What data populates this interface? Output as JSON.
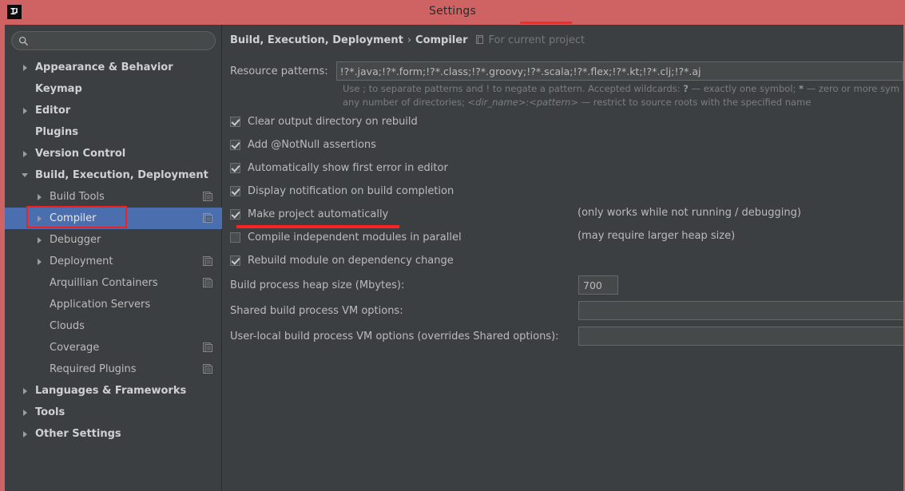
{
  "window": {
    "title": "Settings",
    "logo_icon": "intellij-idea-logo"
  },
  "sidebar": {
    "search": {
      "value": "",
      "placeholder": "",
      "icon": "search-icon"
    },
    "items": [
      {
        "label": "Appearance & Behavior",
        "level": 0,
        "twisty": "right",
        "bold": true,
        "scope_icon": false,
        "selected": false
      },
      {
        "label": "Keymap",
        "level": 0,
        "twisty": "none",
        "bold": true,
        "scope_icon": false,
        "selected": false
      },
      {
        "label": "Editor",
        "level": 0,
        "twisty": "right",
        "bold": true,
        "scope_icon": false,
        "selected": false
      },
      {
        "label": "Plugins",
        "level": 0,
        "twisty": "none",
        "bold": true,
        "scope_icon": false,
        "selected": false
      },
      {
        "label": "Version Control",
        "level": 0,
        "twisty": "right",
        "bold": true,
        "scope_icon": false,
        "selected": false
      },
      {
        "label": "Build, Execution, Deployment",
        "level": 0,
        "twisty": "down",
        "bold": true,
        "scope_icon": false,
        "selected": false
      },
      {
        "label": "Build Tools",
        "level": 1,
        "twisty": "right",
        "bold": false,
        "scope_icon": true,
        "selected": false
      },
      {
        "label": "Compiler",
        "level": 1,
        "twisty": "right",
        "bold": false,
        "scope_icon": true,
        "selected": true
      },
      {
        "label": "Debugger",
        "level": 1,
        "twisty": "right",
        "bold": false,
        "scope_icon": false,
        "selected": false
      },
      {
        "label": "Deployment",
        "level": 1,
        "twisty": "right",
        "bold": false,
        "scope_icon": true,
        "selected": false
      },
      {
        "label": "Arquillian Containers",
        "level": 1,
        "twisty": "none",
        "bold": false,
        "scope_icon": true,
        "selected": false
      },
      {
        "label": "Application Servers",
        "level": 1,
        "twisty": "none",
        "bold": false,
        "scope_icon": false,
        "selected": false
      },
      {
        "label": "Clouds",
        "level": 1,
        "twisty": "none",
        "bold": false,
        "scope_icon": false,
        "selected": false
      },
      {
        "label": "Coverage",
        "level": 1,
        "twisty": "none",
        "bold": false,
        "scope_icon": true,
        "selected": false
      },
      {
        "label": "Required Plugins",
        "level": 1,
        "twisty": "none",
        "bold": false,
        "scope_icon": true,
        "selected": false
      },
      {
        "label": "Languages & Frameworks",
        "level": 0,
        "twisty": "right",
        "bold": true,
        "scope_icon": false,
        "selected": false
      },
      {
        "label": "Tools",
        "level": 0,
        "twisty": "right",
        "bold": true,
        "scope_icon": false,
        "selected": false
      },
      {
        "label": "Other Settings",
        "level": 0,
        "twisty": "right",
        "bold": true,
        "scope_icon": false,
        "selected": false
      }
    ]
  },
  "content": {
    "breadcrumb": {
      "parent": "Build, Execution, Deployment",
      "separator": "›",
      "current": "Compiler",
      "scope_icon": "project-scope-icon",
      "scope_text": "For current project"
    },
    "resource_patterns": {
      "label": "Resource patterns:",
      "value": "!?*.java;!?*.form;!?*.class;!?*.groovy;!?*.scala;!?*.flex;!?*.kt;!?*.clj;!?*.aj"
    },
    "hint_line1_a": "Use ; to separate patterns and ! to negate a pattern. Accepted wildcards: ",
    "hint_wildcard_q": "?",
    "hint_line1_b": " — exactly one symbol; ",
    "hint_wildcard_star": "*",
    "hint_line1_c": " — zero or more sym",
    "hint_line2_a": "any number of directories;  ",
    "hint_dir_name": "<dir_name>:<pattern>",
    "hint_line2_b": " — restrict to source roots with the specified name",
    "checkboxes": [
      {
        "label": "Clear output directory on rebuild",
        "checked": true,
        "mnemonic": "l",
        "hint": ""
      },
      {
        "label": "Add @NotNull assertions",
        "checked": true,
        "mnemonic": "a",
        "hint": ""
      },
      {
        "label": "Automatically show first error in editor",
        "checked": true,
        "mnemonic": "e",
        "hint": ""
      },
      {
        "label": "Display notification on build completion",
        "checked": true,
        "mnemonic": "",
        "hint": ""
      },
      {
        "label": "Make project automatically",
        "checked": true,
        "mnemonic": "",
        "hint": "(only works while not running / debugging)"
      },
      {
        "label": "Compile independent modules in parallel",
        "checked": false,
        "mnemonic": "",
        "hint": "(may require larger heap size)"
      },
      {
        "label": "Rebuild module on dependency change",
        "checked": true,
        "mnemonic": "",
        "hint": ""
      }
    ],
    "fields": [
      {
        "label": "Build process heap size (Mbytes):",
        "value": "700",
        "wide": false
      },
      {
        "label": "Shared build process VM options:",
        "value": "",
        "wide": true
      },
      {
        "label": "User-local build process VM options (overrides Shared options):",
        "value": "",
        "wide": true
      }
    ]
  },
  "annotations": {
    "title_underline_color": "#fb2828",
    "compiler_box_color": "#f42020",
    "make_project_underline_color": "#fb2424"
  },
  "colors": {
    "titlebar": "#cf6363",
    "window_bg": "#3c3f41",
    "selection": "#4b6eaf",
    "input_bg": "#45494a",
    "text": "#bbbbbb",
    "muted_text": "#7b7d7e"
  }
}
